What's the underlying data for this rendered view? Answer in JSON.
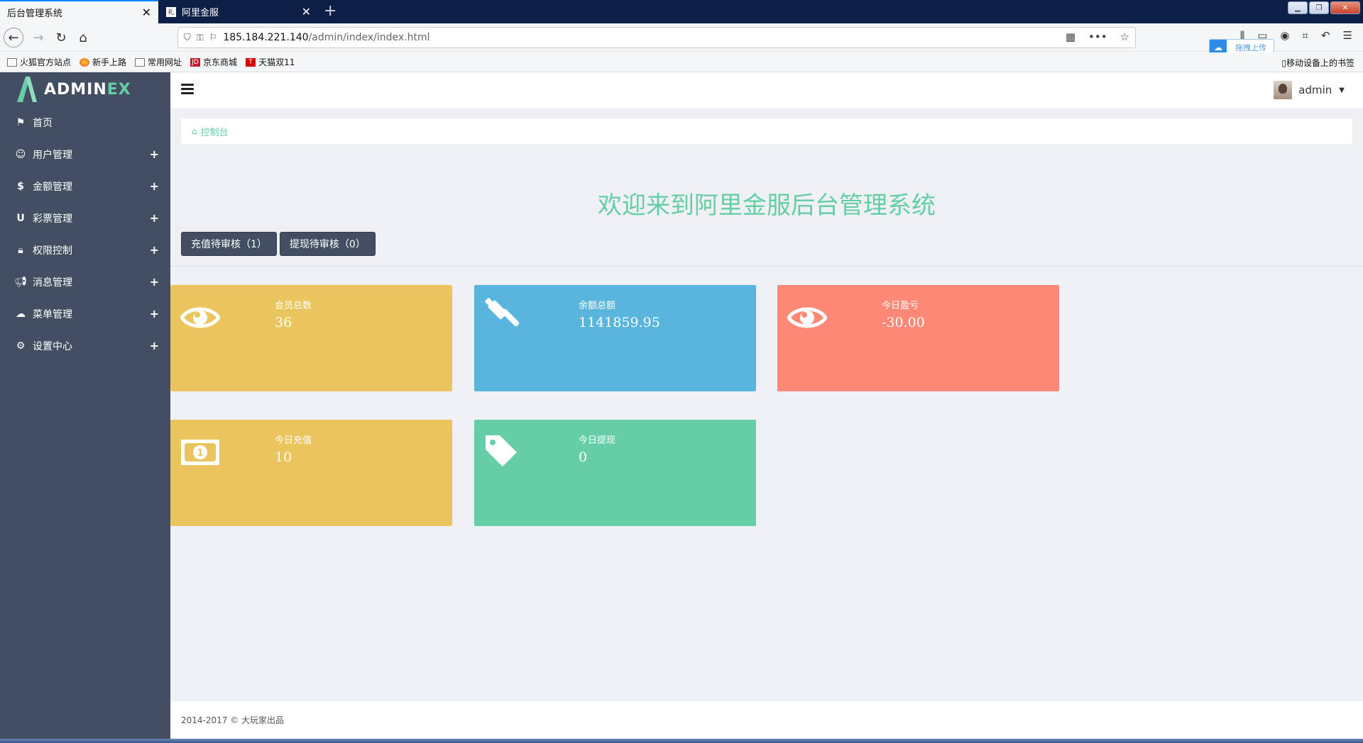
{
  "browser": {
    "tabs": [
      {
        "title": "后台管理系统",
        "active": true
      },
      {
        "title": "阿里金服",
        "active": false
      }
    ],
    "url_host": "185.184.221.140",
    "url_path": "/admin/index/index.html",
    "upload_label": "拖拽上传",
    "bookmarks": [
      "火狐官方站点",
      "新手上路",
      "常用网址",
      "京东商城",
      "天猫双11"
    ],
    "mobile_bookmarks": "移动设备上的书签"
  },
  "app": {
    "logo_text_a": "ADMIN",
    "logo_text_b": "EX",
    "user": "admin",
    "menu": [
      {
        "label": "首页",
        "icon": "flag-icon",
        "expandable": false
      },
      {
        "label": "用户管理",
        "icon": "smile-icon",
        "expandable": true
      },
      {
        "label": "金额管理",
        "icon": "dollar-icon",
        "expandable": true
      },
      {
        "label": "彩票管理",
        "icon": "magnet-icon",
        "expandable": true
      },
      {
        "label": "权限控制",
        "icon": "lock-icon",
        "expandable": true
      },
      {
        "label": "消息管理",
        "icon": "bullhorn-icon",
        "expandable": true
      },
      {
        "label": "菜单管理",
        "icon": "cloud-icon",
        "expandable": true
      },
      {
        "label": "设置中心",
        "icon": "gear-icon",
        "expandable": true
      }
    ],
    "breadcrumb": "控制台",
    "welcome": "欢迎来到阿里金服后台管理系统",
    "buttons": [
      "充值待审核（1）",
      "提现待审核（0）"
    ],
    "cards": [
      {
        "label": "会员总数",
        "value": "36",
        "icon": "eye-icon",
        "color": "#eac55d"
      },
      {
        "label": "余额总额",
        "value": "1141859.95",
        "icon": "gavel-icon",
        "color": "#5ab5de"
      },
      {
        "label": "今日盈亏",
        "value": "-30.00",
        "icon": "eye-icon",
        "color": "#fd8875"
      },
      {
        "label": "今日充值",
        "value": "10",
        "icon": "money-icon",
        "color": "#eac55d"
      },
      {
        "label": "今日提现",
        "value": "0",
        "icon": "tag-icon",
        "color": "#65cea7"
      }
    ],
    "footer": "2014-2017 © 大玩家出品"
  }
}
